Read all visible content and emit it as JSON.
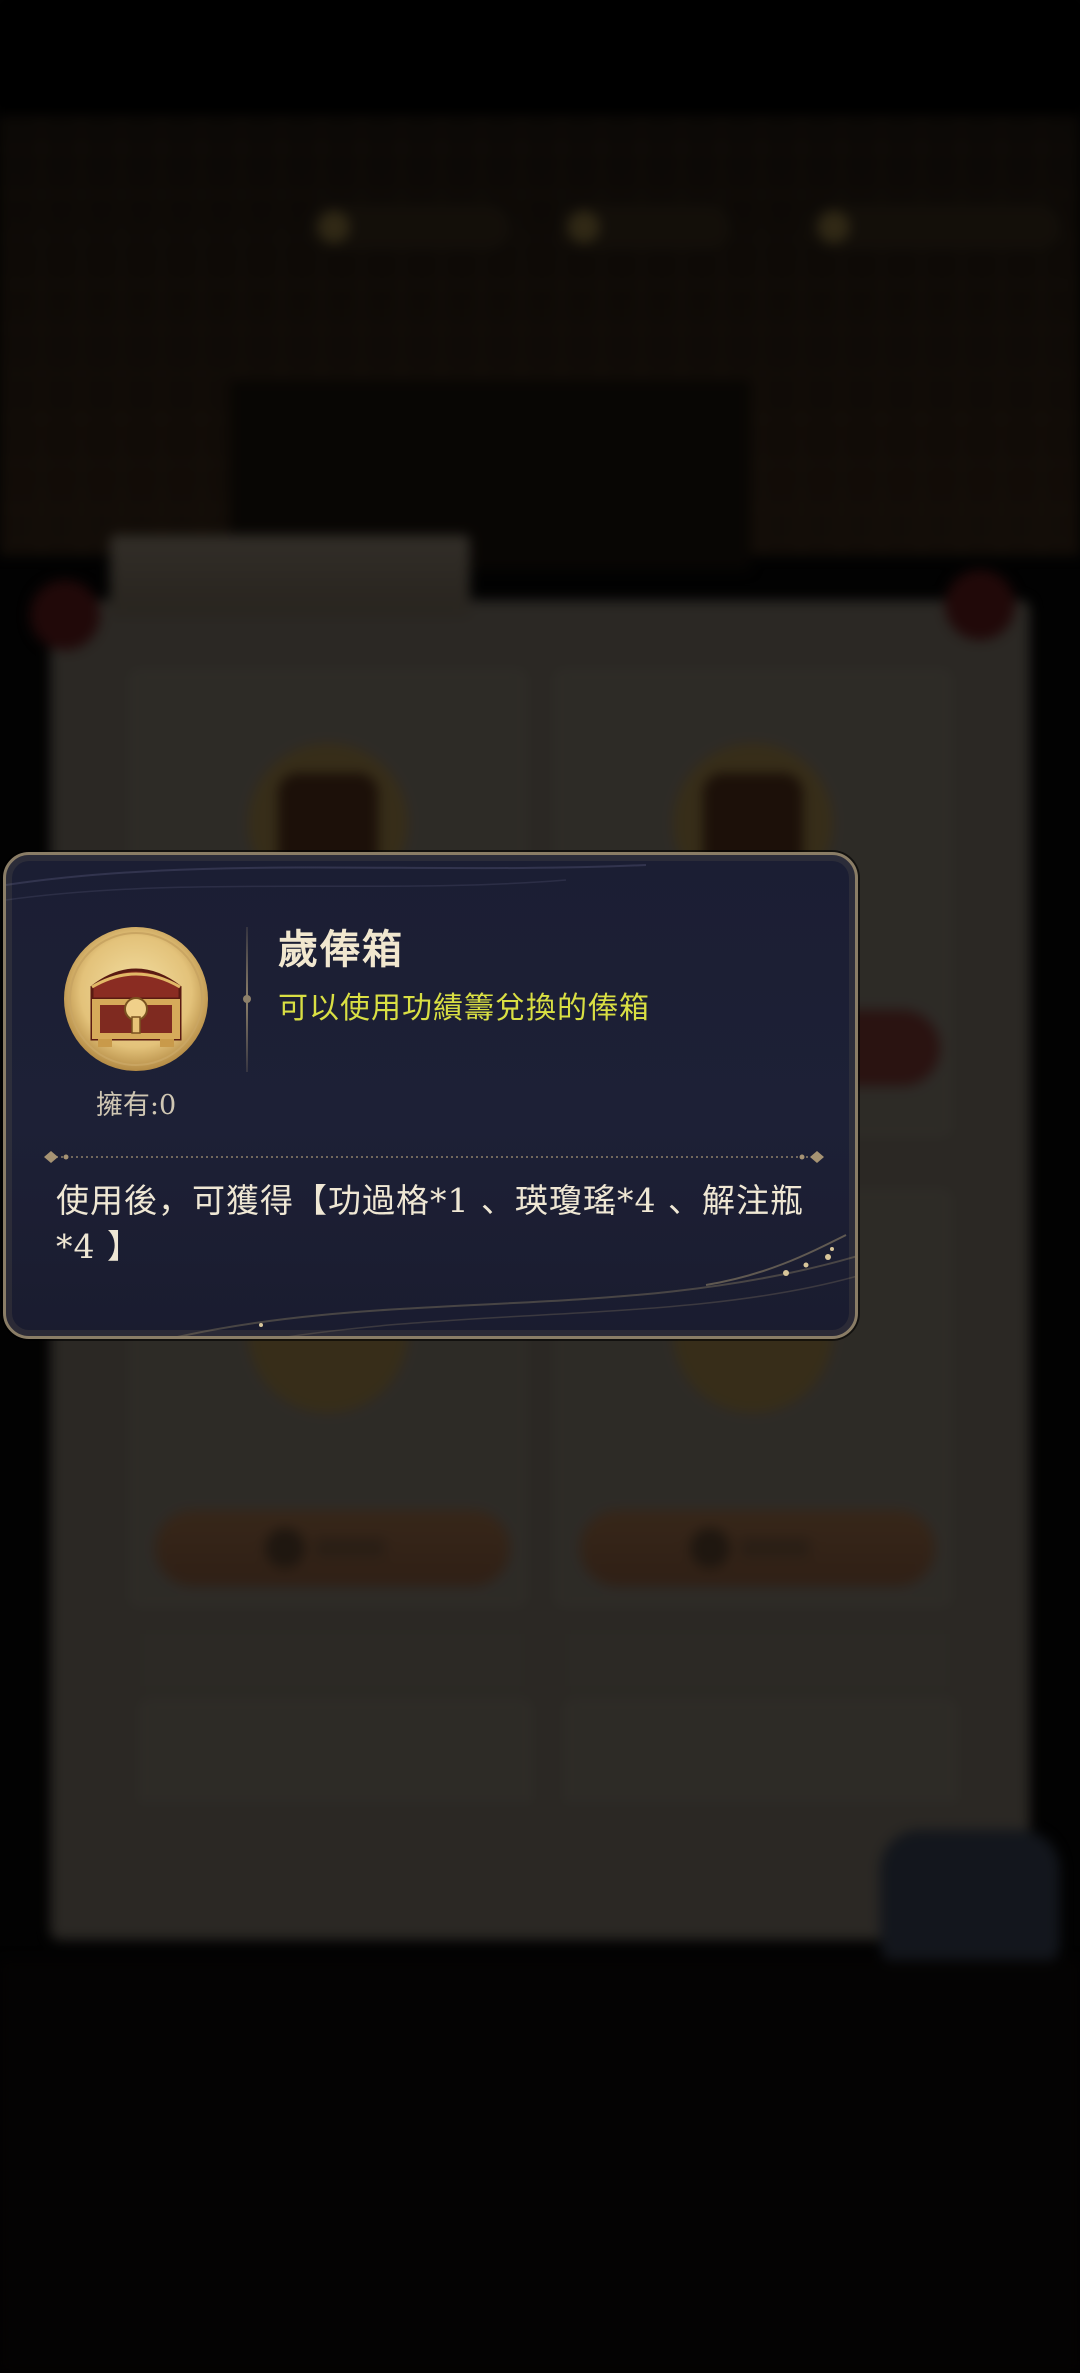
{
  "popup": {
    "item_name": "歲俸箱",
    "item_subtitle": "可以使用功績籌兌換的俸箱",
    "owned_label": "擁有:0",
    "description": "使用後，可獲得【功過格*1 、瑛瓊瑤*4 、解注瓶*4 】"
  },
  "icons": {
    "item": "treasure-chest-icon"
  },
  "colors": {
    "popup_bg": "#1c1f34",
    "popup_border": "#8a7d66",
    "title": "#f1e7cf",
    "subtitle": "#d9df43",
    "body_text": "#efe7d4"
  }
}
